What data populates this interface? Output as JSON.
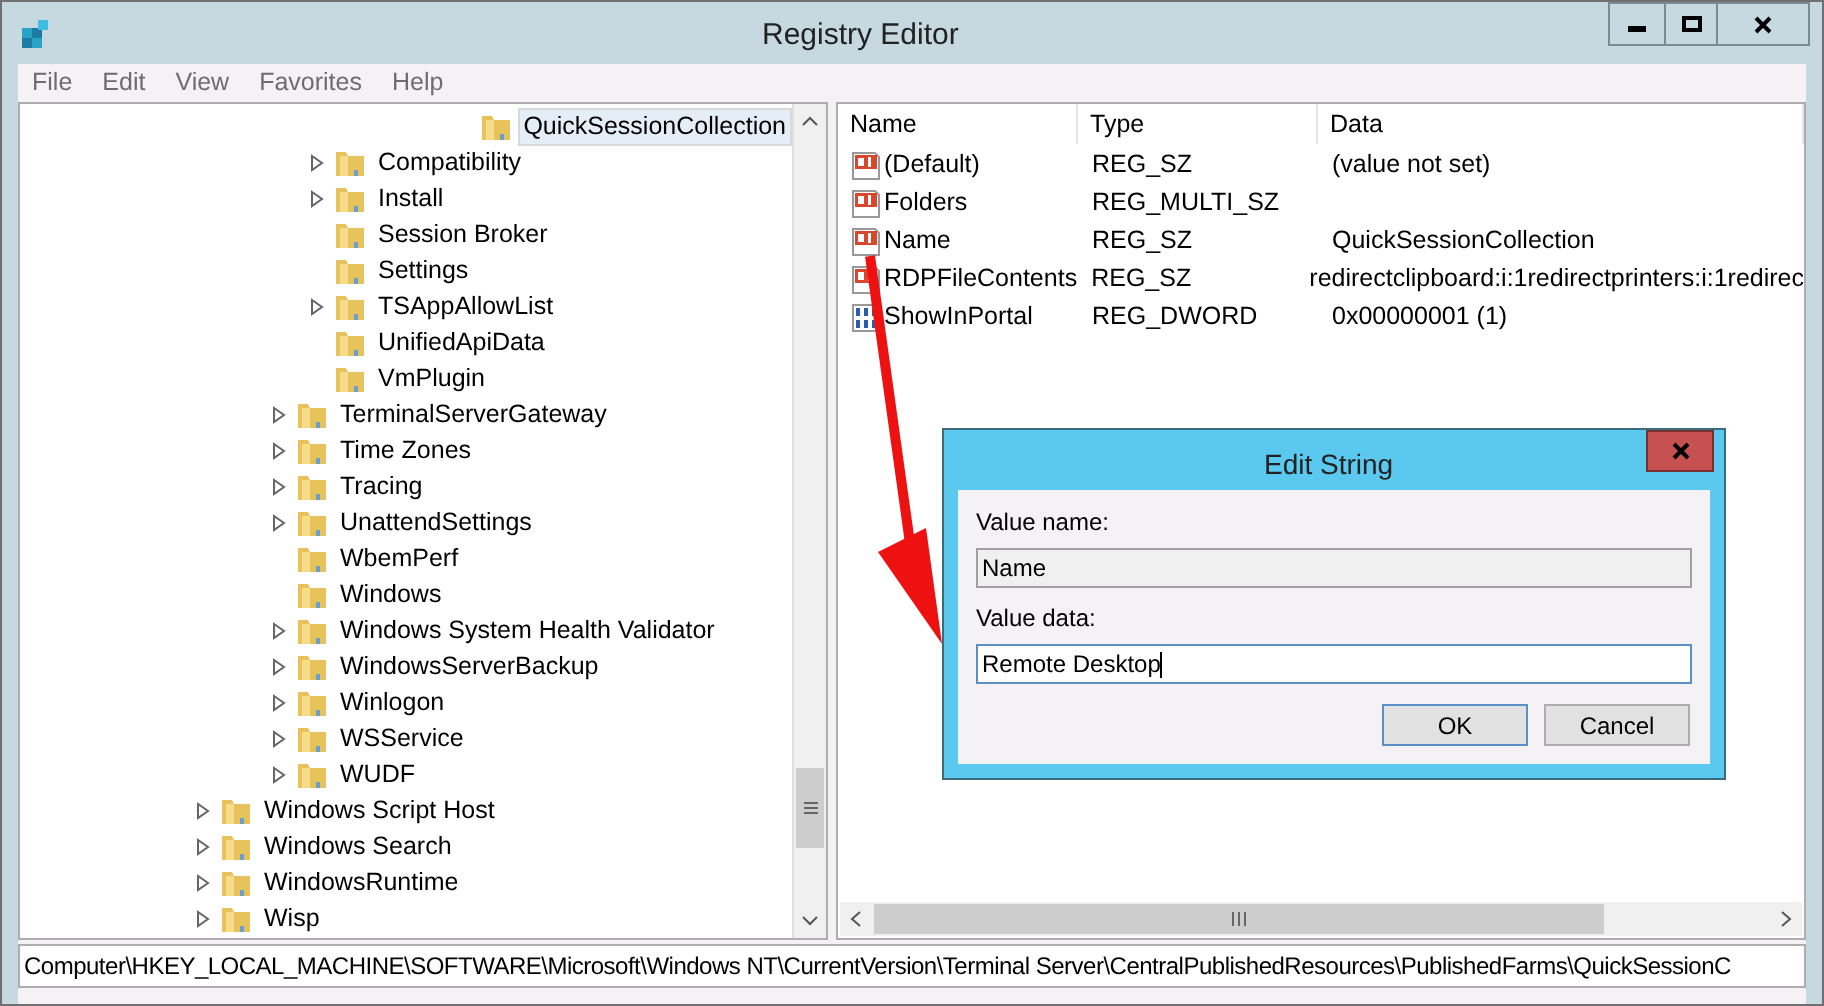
{
  "window": {
    "title": "Registry Editor"
  },
  "menu": [
    "File",
    "Edit",
    "View",
    "Favorites",
    "Help"
  ],
  "tree": [
    {
      "children": [
        {
          "children": [
            {
              "children": [
                {
                  "children": [
                    {
                      "children": [
                        {
                          "children": [
                            {
                              "children": [
                                {
                                  "label": "QuickSessionCollection",
                                  "expandable": false,
                                  "selected": true
                                }
                              ]
                            }
                          ]
                        }
                      ]
                    }
                  ]
                },
                {
                  "label": "Compatibility",
                  "expandable": true,
                  "selected": false
                },
                {
                  "label": "Install",
                  "expandable": true,
                  "selected": false
                },
                {
                  "label": "Session Broker",
                  "expandable": false,
                  "selected": false
                },
                {
                  "label": "Settings",
                  "expandable": false,
                  "selected": false
                },
                {
                  "label": "TSAppAllowList",
                  "expandable": true,
                  "selected": false
                },
                {
                  "label": "UnifiedApiData",
                  "expandable": false,
                  "selected": false
                },
                {
                  "label": "VmPlugin",
                  "expandable": false,
                  "selected": false
                }
              ]
            },
            {
              "label": "TerminalServerGateway",
              "expandable": true,
              "selected": false
            },
            {
              "label": "Time Zones",
              "expandable": true,
              "selected": false
            },
            {
              "label": "Tracing",
              "expandable": true,
              "selected": false
            },
            {
              "label": "UnattendSettings",
              "expandable": true,
              "selected": false
            },
            {
              "label": "WbemPerf",
              "expandable": false,
              "selected": false
            },
            {
              "label": "Windows",
              "expandable": false,
              "selected": false
            },
            {
              "label": "Windows System Health Validator",
              "expandable": true,
              "selected": false
            },
            {
              "label": "WindowsServerBackup",
              "expandable": true,
              "selected": false
            },
            {
              "label": "Winlogon",
              "expandable": true,
              "selected": false
            },
            {
              "label": "WSService",
              "expandable": true,
              "selected": false
            },
            {
              "label": "WUDF",
              "expandable": true,
              "selected": false
            }
          ]
        }
      ]
    },
    {
      "label": "Windows Script Host",
      "expandable": true,
      "selected": false
    },
    {
      "label": "Windows Search",
      "expandable": true,
      "selected": false
    },
    {
      "label": "WindowsRuntime",
      "expandable": true,
      "selected": false
    },
    {
      "label": "Wisp",
      "expandable": true,
      "selected": false
    }
  ],
  "values": {
    "columns": [
      "Name",
      "Type",
      "Data"
    ],
    "rows": [
      {
        "kind": "string",
        "name": "(Default)",
        "type": "REG_SZ",
        "data": "(value not set)"
      },
      {
        "kind": "string",
        "name": "Folders",
        "type": "REG_MULTI_SZ"
      },
      {
        "kind": "string",
        "name": "Name",
        "type": "REG_SZ",
        "data": "QuickSessionCollection"
      },
      {
        "kind": "string",
        "name": "RDPFileContents",
        "type": "REG_SZ",
        "data": "redirectclipboard:i:1redirectprinters:i:1redirec"
      },
      {
        "kind": "binary",
        "name": "ShowInPortal",
        "type": "REG_DWORD",
        "data": "0x00000001 (1)"
      }
    ]
  },
  "dialog": {
    "title": "Edit String",
    "name_label": "Value name:",
    "name_value": "Name",
    "data_label": "Value data:",
    "data_value": "Remote Desktop",
    "buttons": [
      "OK",
      "Cancel"
    ]
  },
  "status_bar": "Computer\\HKEY_LOCAL_MACHINE\\SOFTWARE\\Microsoft\\Windows NT\\CurrentVersion\\Terminal Server\\CentralPublishedResources\\PublishedFarms\\QuickSessionC"
}
